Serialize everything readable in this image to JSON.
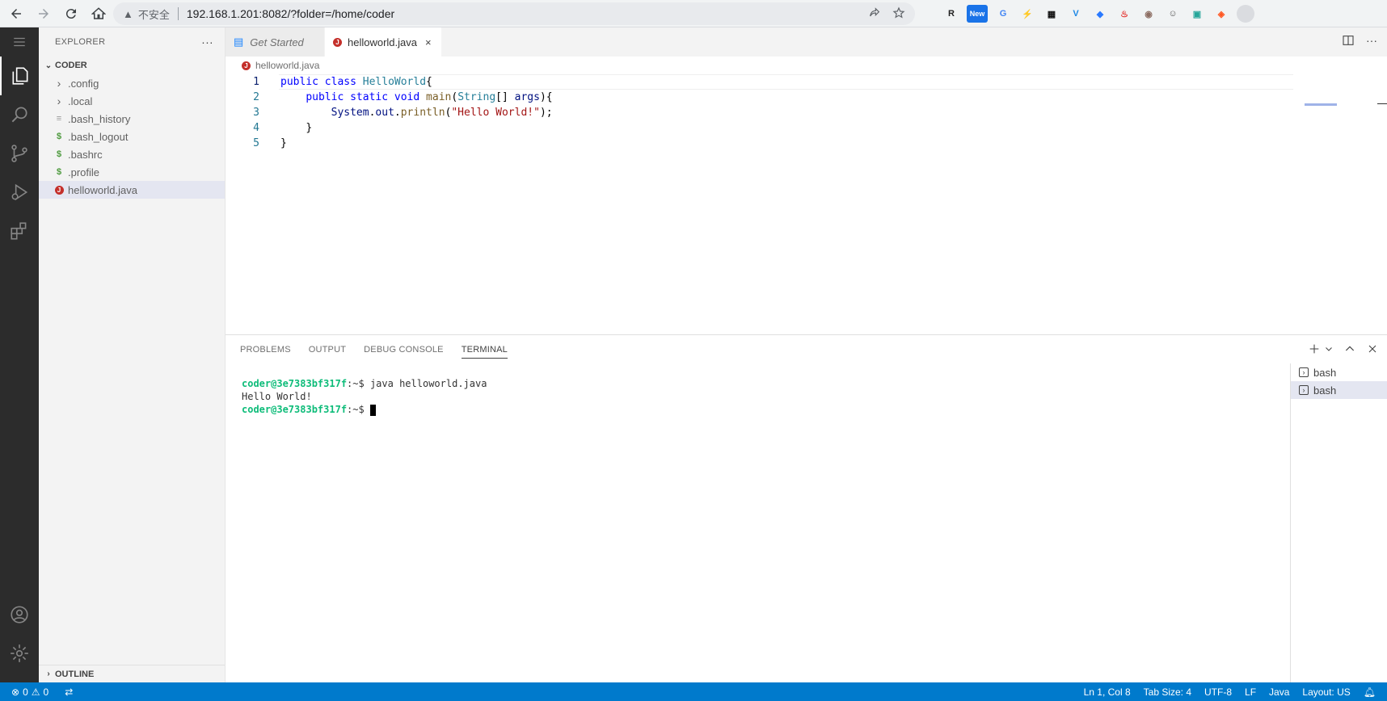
{
  "browser": {
    "security_label": "不安全",
    "url": "192.168.1.201:8082/?folder=/home/coder",
    "extensions": [
      {
        "label": "R",
        "color": "#222222"
      },
      {
        "label": "New",
        "color": "#1a73e8"
      },
      {
        "label": "G",
        "color": "#4285f4"
      },
      {
        "label": "⚡",
        "color": "#333333"
      },
      {
        "label": "▦",
        "color": "#111111"
      },
      {
        "label": "V",
        "color": "#1e88e5"
      },
      {
        "label": "◆",
        "color": "#2979ff"
      },
      {
        "label": "♨",
        "color": "#e53935"
      },
      {
        "label": "◉",
        "color": "#8d6e63"
      },
      {
        "label": "☺",
        "color": "#555555"
      },
      {
        "label": "▣",
        "color": "#26a69a"
      },
      {
        "label": "◈",
        "color": "#ff5722"
      }
    ]
  },
  "explorer": {
    "title": "EXPLORER",
    "more": "···",
    "folder": "CODER",
    "items": [
      {
        "name": ".config",
        "kind": "folder"
      },
      {
        "name": ".local",
        "kind": "folder"
      },
      {
        "name": ".bash_history",
        "kind": "text"
      },
      {
        "name": ".bash_logout",
        "kind": "shell"
      },
      {
        "name": ".bashrc",
        "kind": "shell"
      },
      {
        "name": ".profile",
        "kind": "shell"
      },
      {
        "name": "helloworld.java",
        "kind": "java",
        "selected": true
      }
    ],
    "outline": "OUTLINE"
  },
  "editor": {
    "tabs": [
      {
        "label": "Get Started",
        "active": false
      },
      {
        "label": "helloworld.java",
        "active": true,
        "close": "×"
      }
    ],
    "breadcrumb": "helloworld.java",
    "lines": [
      "1",
      "2",
      "3",
      "4",
      "5"
    ],
    "code": {
      "l1": {
        "kw1": "public",
        "kw2": "class",
        "name": "HelloWorld",
        "brace": "{"
      },
      "l2": {
        "kw1": "public",
        "kw2": "static",
        "kw3": "void",
        "fn": "main",
        "open": "(",
        "type": "String",
        "arr": "[] ",
        "arg": "args",
        "close": "){"
      },
      "l3": {
        "obj": "System",
        "dot1": ".",
        "out": "out",
        "dot2": ".",
        "fn": "println",
        "open": "(",
        "str": "\"Hello World!\"",
        "close": ");"
      },
      "l4": "}",
      "l5": "}"
    }
  },
  "panel": {
    "tabs": [
      "PROBLEMS",
      "OUTPUT",
      "DEBUG CONSOLE",
      "TERMINAL"
    ],
    "active_tab": "TERMINAL",
    "terminal": {
      "prompt1": "coder@3e7383bf317f",
      "path1": ":~$ ",
      "cmd1": "java helloworld.java",
      "output": "Hello World!",
      "prompt2": "coder@3e7383bf317f",
      "path2": ":~$ "
    },
    "terminals": [
      {
        "label": "bash",
        "selected": false
      },
      {
        "label": "bash",
        "selected": true
      }
    ]
  },
  "status": {
    "errors": "0",
    "warnings": "0",
    "position": "Ln 1, Col 8",
    "tab_size": "Tab Size: 4",
    "encoding": "UTF-8",
    "eol": "LF",
    "language": "Java",
    "layout": "Layout: US"
  },
  "colors": {
    "status_bar": "#007acc",
    "activity_bar": "#2c2c2c",
    "prompt": "#0dbc79"
  }
}
